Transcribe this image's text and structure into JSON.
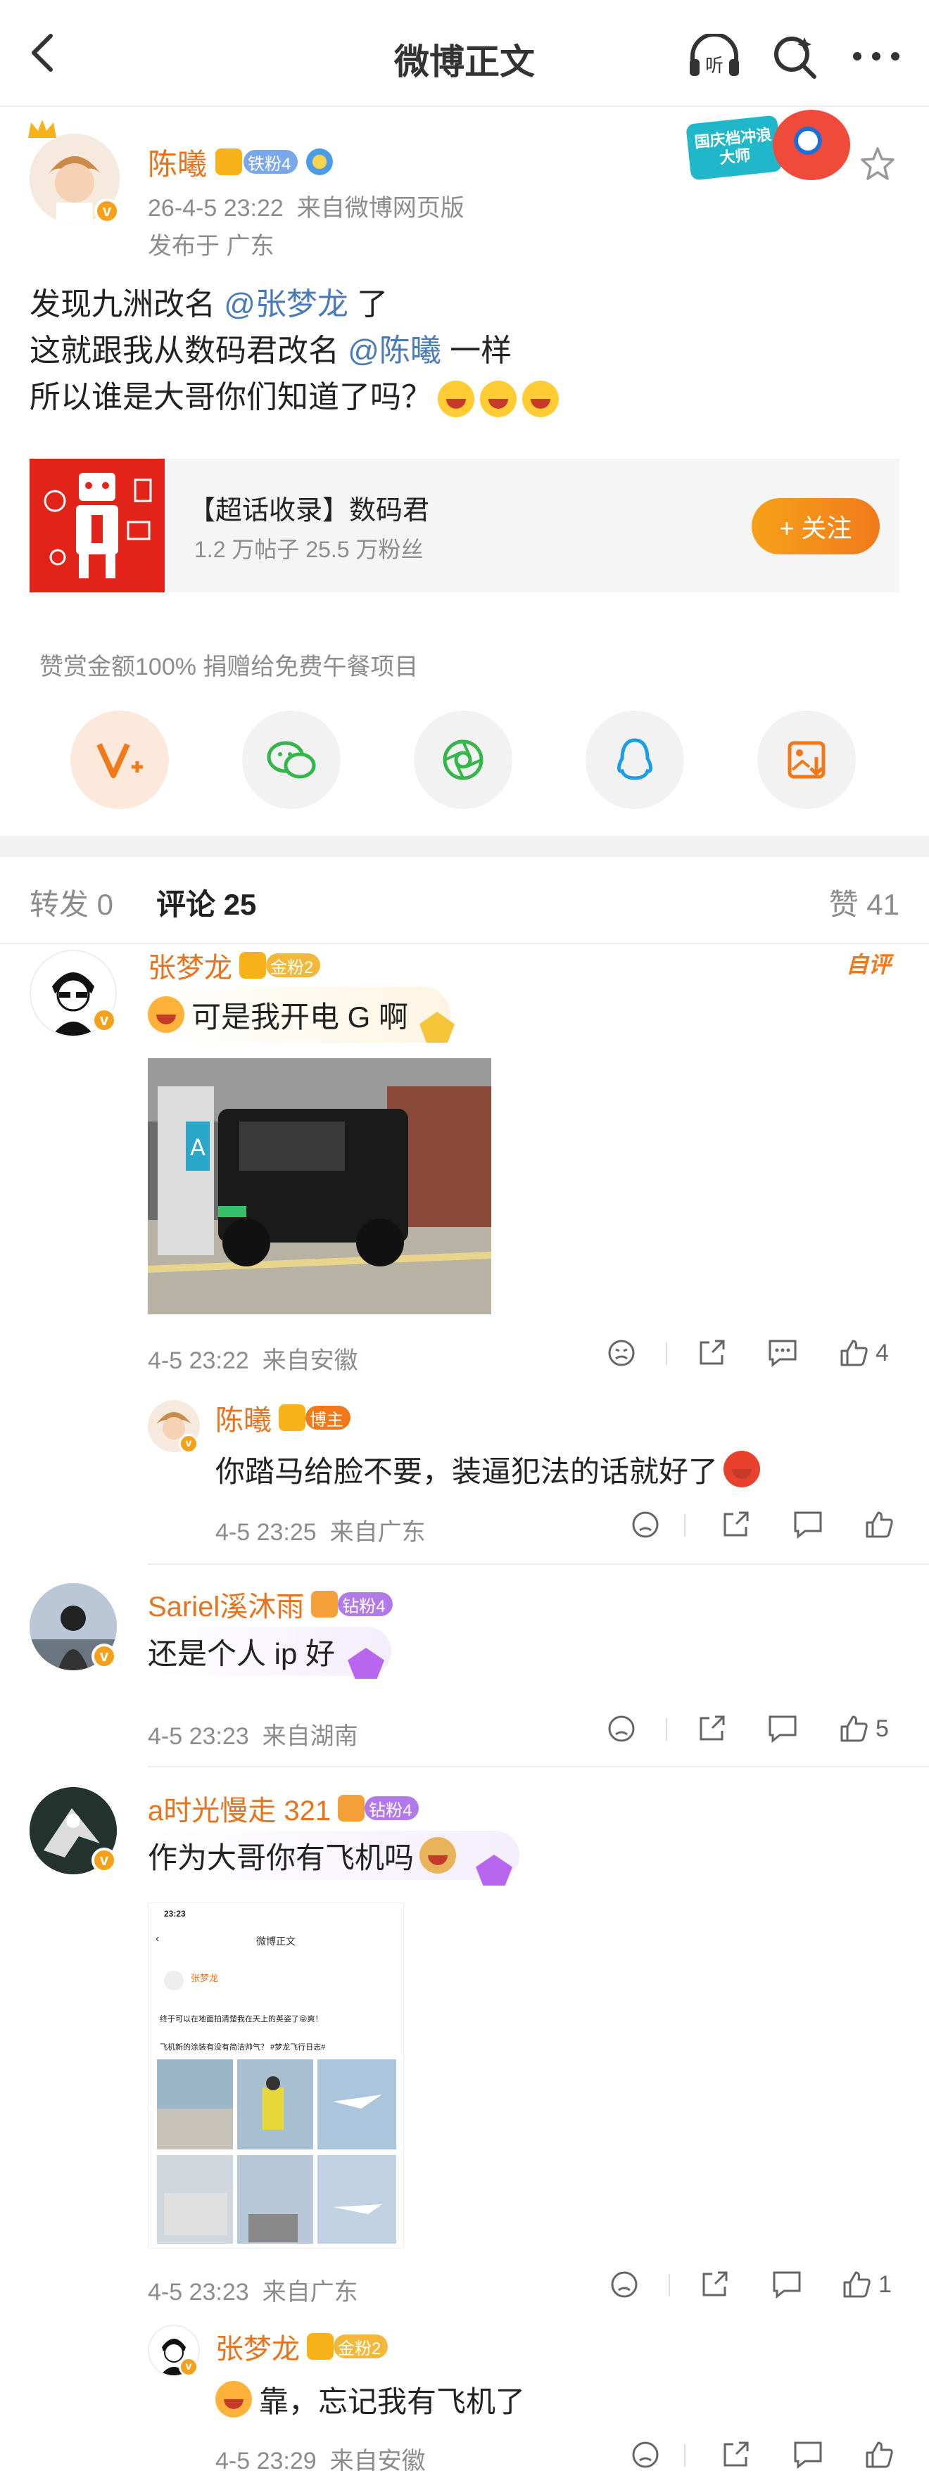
{
  "header": {
    "title": "微博正文"
  },
  "post": {
    "author": "陈曦",
    "fan_badge": "铁粉4",
    "time": "26-4-5 23:22",
    "source": "来自微博网页版",
    "location": "发布于 广东",
    "promo_text": "国庆档冲浪大师",
    "line1_a": "发现九洲改名",
    "line1_mention": "@张梦龙",
    "line1_b": " 了",
    "line2_a": "这就跟我从数码君改名",
    "line2_mention": "@陈曦",
    "line2_b": " 一样",
    "line3": "所以谁是大哥你们知道了吗？"
  },
  "topic_card": {
    "title": "【超话收录】数码君",
    "stats": "1.2 万帖子  25.5 万粉丝",
    "follow_label": "+ 关注"
  },
  "reward": {
    "text": "赞赏金额100% 捐赠给免费午餐项目"
  },
  "tabs": {
    "repost": "转发 0",
    "comment": "评论 25",
    "like": "赞 41"
  },
  "comments": [
    {
      "name": "张梦龙",
      "badge": "金粉2",
      "author_tag": "自评",
      "text": "可是我开电 G 啊",
      "time": "4-5 23:22",
      "source": "来自安徽",
      "likes": "4",
      "reply": {
        "name": "陈曦",
        "badge": "博主",
        "text": "你踏马给脸不要，装逼犯法的话就好了",
        "time": "4-5 23:25",
        "source": "来自广东"
      }
    },
    {
      "name": "Sariel溪沐雨",
      "badge": "钻粉4",
      "text": "还是个人 ip 好",
      "time": "4-5 23:23",
      "source": "来自湖南",
      "likes": "5"
    },
    {
      "name": "a时光慢走 321",
      "badge": "钻粉4",
      "text": "作为大哥你有飞机吗",
      "time": "4-5 23:23",
      "source": "来自广东",
      "likes": "1",
      "screenshot": {
        "time": "23:23",
        "title": "微博正文",
        "name": "张梦龙",
        "line": "终于可以在地面拍清楚我在天上的英姿了😜爽！",
        "line2": "飞机新的涂装有没有简洁帅气？ #梦龙飞行日志#"
      },
      "reply": {
        "name": "张梦龙",
        "badge": "金粉2",
        "text": "靠，忘记我有飞机了",
        "time": "4-5 23:29",
        "source": "来自安徽"
      }
    }
  ],
  "colors": {
    "accent": "#f7861c",
    "name": "#e8731c",
    "mention": "#4a7ab7"
  }
}
